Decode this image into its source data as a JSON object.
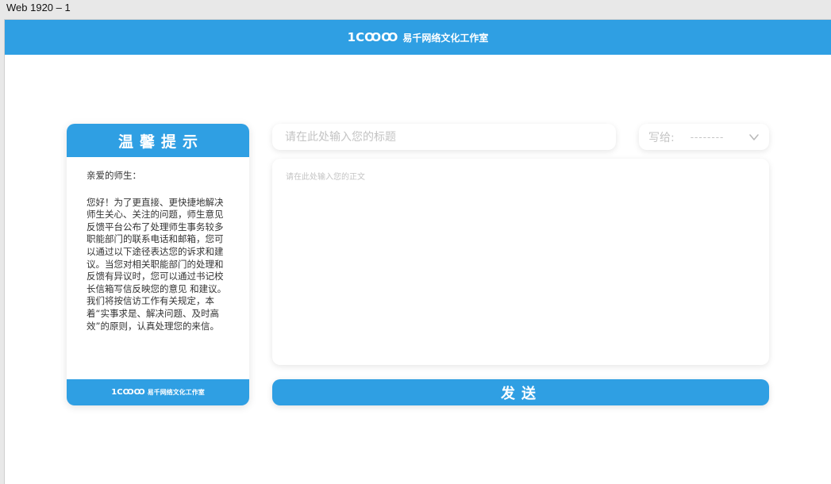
{
  "frame": {
    "label": "Web 1920 – 1"
  },
  "header": {
    "logo_mark": "1CꝎꝎ",
    "logo_text": "易千网络文化工作室"
  },
  "tip": {
    "title": "温馨提示",
    "greeting": "亲爱的师生：",
    "paragraph": "您好！为了更直接、更快捷地解决师生关心、关注的问题，师生意见反馈平台公布了处理师生事务较多职能部门的联系电话和邮箱，您可以通过以下途径表达您的诉求和建议。当您对相关职能部门的处理和反馈有异议时，您可以通过书记校长信箱写信反映您的意见 和建议。我们将按信访工作有关规定，本着“实事求是、解决问题、及时高效”的原则，认真处理您的来信。",
    "footer_logo_mark": "1CꝎꝎ",
    "footer_logo_text": "易千网络文化工作室"
  },
  "form": {
    "title_placeholder": "请在此处输入您的标题",
    "recipient_label": "写给:",
    "recipient_value": "--------",
    "body_placeholder": "请在此处输入您的正文",
    "send_label": "发送"
  },
  "colors": {
    "accent": "#2f9fe3",
    "placeholder": "#c4c4c4"
  },
  "icons": {
    "recipient_dropdown": "chevron-down-icon"
  }
}
